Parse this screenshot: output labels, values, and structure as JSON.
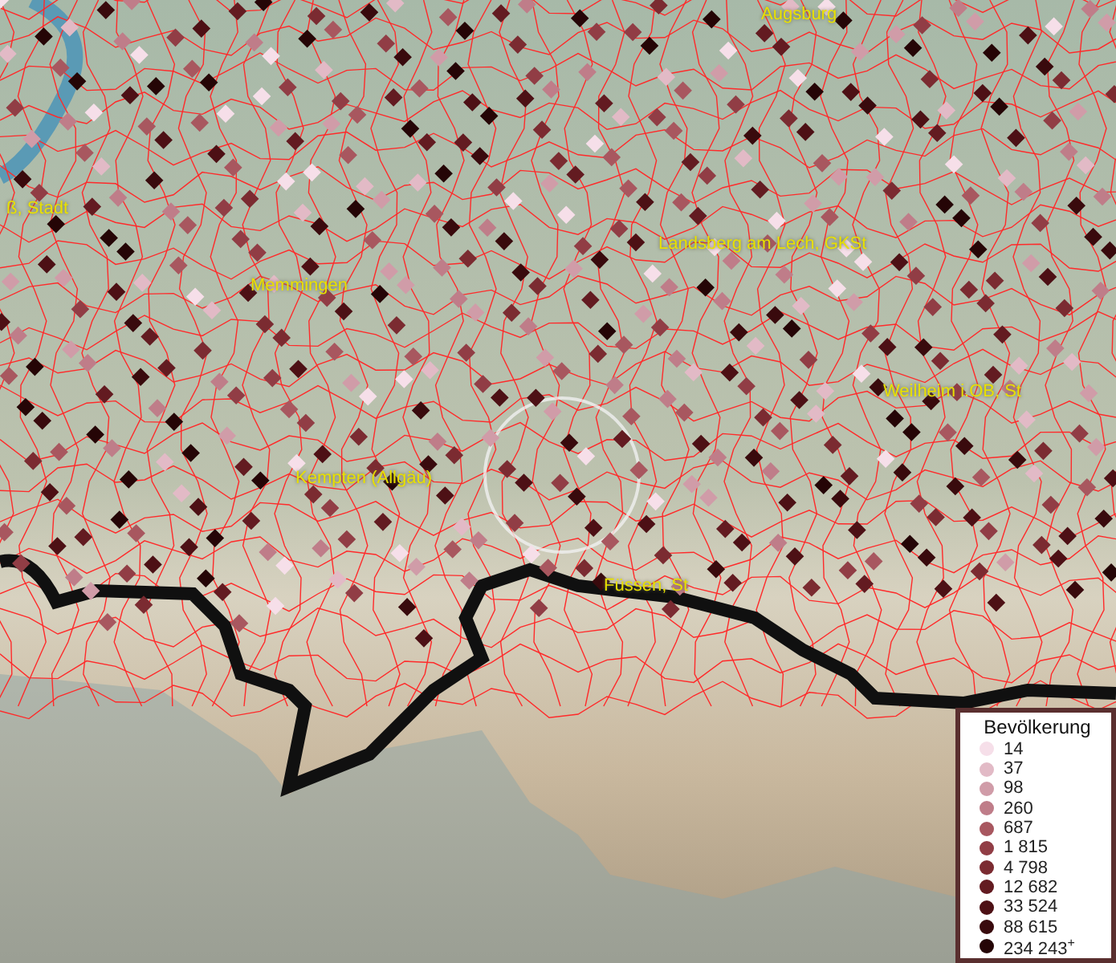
{
  "map": {
    "labels": [
      {
        "text": "Augsburg"
      },
      {
        "text": "ß, Stadt"
      },
      {
        "text": "Landsberg am Lech, GKSt"
      },
      {
        "text": "Memmingen"
      },
      {
        "text": "Weilheim i.OB, St"
      },
      {
        "text": "Kempten (Allgäu)"
      },
      {
        "text": "Füssen, St"
      }
    ]
  },
  "legend": {
    "title": "Bevölkerung",
    "items": [
      {
        "label": "14",
        "color": "#f6dfe9"
      },
      {
        "label": "37",
        "color": "#e2bac6"
      },
      {
        "label": "98",
        "color": "#d09ca8"
      },
      {
        "label": "260",
        "color": "#bf7d89"
      },
      {
        "label": "687",
        "color": "#a8575f"
      },
      {
        "label": "1 815",
        "color": "#913d45"
      },
      {
        "label": "4 798",
        "color": "#7b2b31"
      },
      {
        "label": "12 682",
        "color": "#631b21"
      },
      {
        "label": "33 524",
        "color": "#4d1015"
      },
      {
        "label": "88 615",
        "color": "#390a0d"
      },
      {
        "label": "234 243$^{+}$",
        "color": "#250506"
      }
    ]
  }
}
